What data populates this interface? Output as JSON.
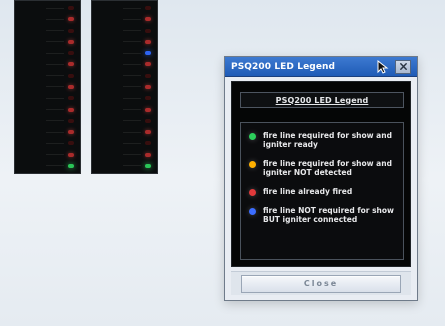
{
  "dialog": {
    "title": "PSQ200 LED Legend",
    "header_label": "PSQ200 LED Legend",
    "close_button_label": "Close"
  },
  "legend": {
    "items": [
      {
        "color_name": "green",
        "color": "#2ccf5b",
        "text": "fire line required for show and igniter ready"
      },
      {
        "color_name": "orange",
        "color": "#ffb000",
        "text": "fire line required for show and igniter NOT detected"
      },
      {
        "color_name": "red",
        "color": "#e0393b",
        "text": "fire line already fired"
      },
      {
        "color_name": "blue",
        "color": "#3c6dff",
        "text": "fire line NOT required for show BUT igniter connected"
      }
    ]
  },
  "icons": {
    "pointer": "mouse-pointer-icon",
    "close": "close-x-icon"
  }
}
